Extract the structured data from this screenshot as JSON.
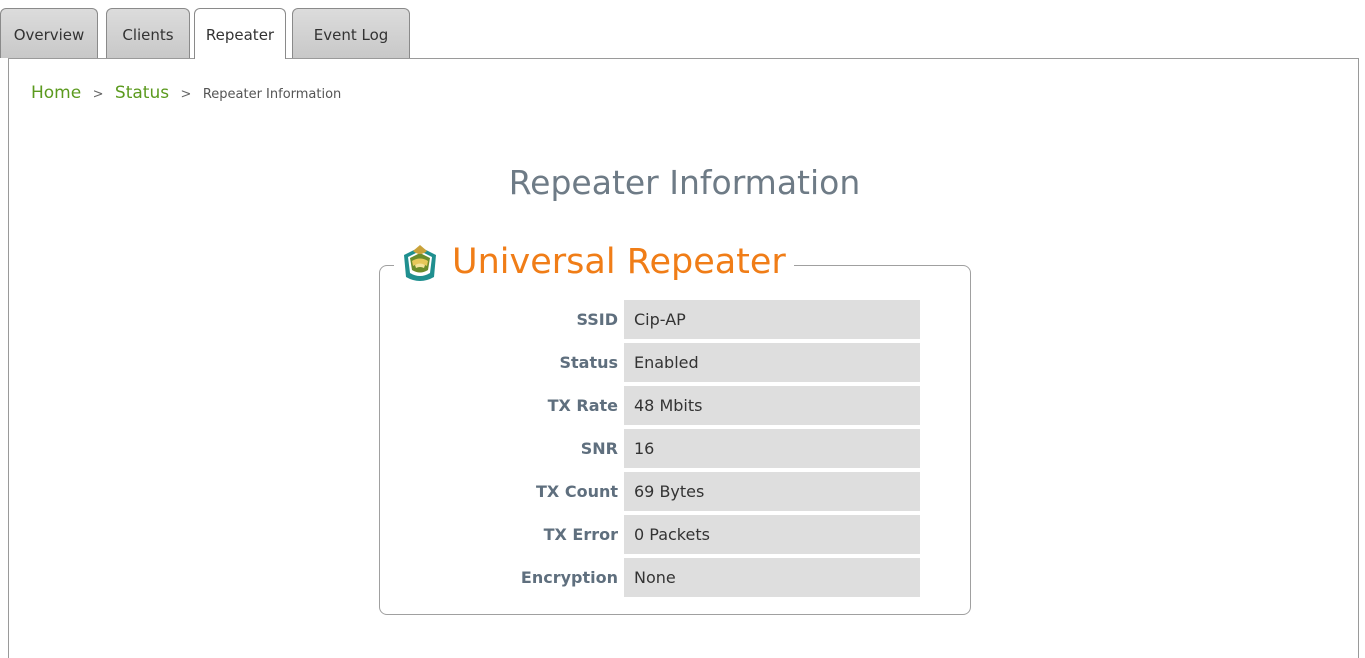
{
  "tabs": [
    {
      "label": "Overview",
      "active": false
    },
    {
      "label": "Clients",
      "active": false
    },
    {
      "label": "Repeater",
      "active": true
    },
    {
      "label": "Event Log",
      "active": false
    }
  ],
  "breadcrumb": {
    "home": "Home",
    "separator": ">",
    "status": "Status",
    "current": "Repeater Information"
  },
  "page_title": "Repeater Information",
  "section": {
    "title": "Universal Repeater",
    "icon": "universal-repeater-icon",
    "rows": [
      {
        "label": "SSID",
        "value": "Cip-AP"
      },
      {
        "label": "Status",
        "value": "Enabled"
      },
      {
        "label": "TX Rate",
        "value": "48 Mbits"
      },
      {
        "label": "SNR",
        "value": "16"
      },
      {
        "label": "TX Count",
        "value": "69 Bytes"
      },
      {
        "label": "TX Error",
        "value": "0 Packets"
      },
      {
        "label": "Encryption",
        "value": "None"
      }
    ]
  },
  "colors": {
    "link_green": "#5b9a1e",
    "section_orange": "#f07d17",
    "label_slate": "#5f6f7e",
    "value_bg": "#dedede"
  }
}
